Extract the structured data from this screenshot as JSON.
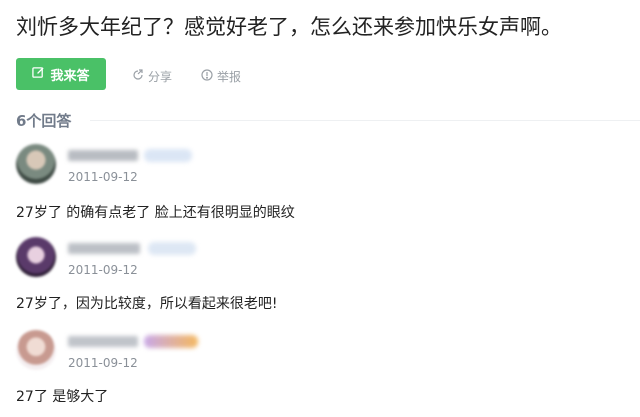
{
  "question": {
    "title": "刘忻多大年纪了？感觉好老了，怎么还来参加快乐女声啊。"
  },
  "actions": {
    "answer_button_label": "我来答",
    "share_label": "分享",
    "report_label": "举报"
  },
  "answers_header": {
    "count_label": "6个回答"
  },
  "answers": [
    {
      "date": "2011-09-12",
      "content": "27岁了 的确有点老了 脸上还有很明显的眼纹"
    },
    {
      "date": "2011-09-12",
      "content": "27岁了，因为比较度，所以看起来很老吧!"
    },
    {
      "date": "2011-09-12",
      "content": "27了 是够大了"
    }
  ],
  "colors": {
    "accent_green": "#4ac167",
    "muted_gray": "#9aa0a6",
    "header_gray": "#717b8a"
  },
  "icons": {
    "answer_button": "pencil-square-icon",
    "share": "share-icon",
    "report": "alert-circle-icon"
  }
}
